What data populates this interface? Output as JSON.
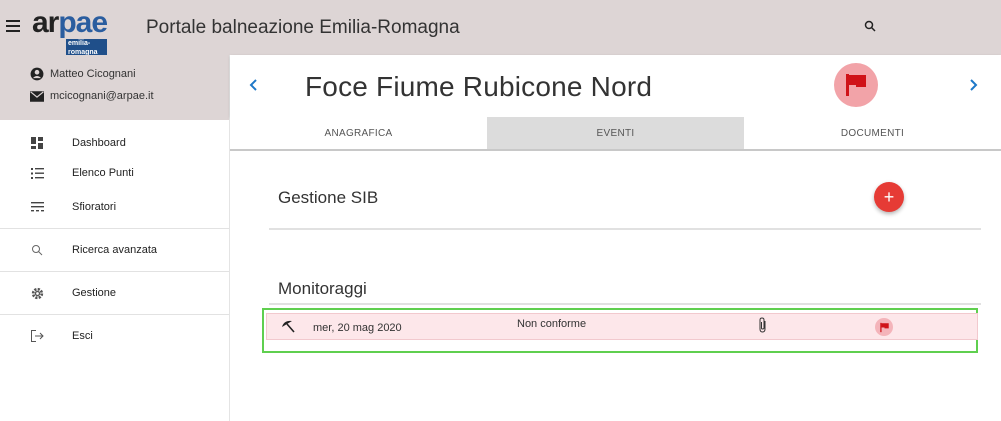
{
  "app": {
    "logo_text_1": "ar",
    "logo_text_2": "pae",
    "logo_sub": "emilia-romagna",
    "title": "Portale balneazione Emilia-Romagna"
  },
  "user": {
    "name": "Matteo Cicognani",
    "email": "mcicognani@arpae.it"
  },
  "sidebar": {
    "items": [
      {
        "label": "Dashboard",
        "icon": "dashboard-icon"
      },
      {
        "label": "Elenco Punti",
        "icon": "list-icon"
      },
      {
        "label": "Sfioratori",
        "icon": "overflow-icon"
      },
      {
        "label": "Ricerca avanzata",
        "icon": "search-icon"
      },
      {
        "label": "Gestione",
        "icon": "gear-icon"
      },
      {
        "label": "Esci",
        "icon": "logout-icon"
      }
    ]
  },
  "station": {
    "name": "Foce Fiume Rubicone Nord",
    "status_icon": "red-flag-icon"
  },
  "tabs": [
    {
      "label": "ANAGRAFICA",
      "active": false
    },
    {
      "label": "EVENTI",
      "active": true
    },
    {
      "label": "DOCUMENTI",
      "active": false
    }
  ],
  "sections": {
    "sib_title": "Gestione SIB",
    "add_label": "+",
    "monitoring_title": "Monitoraggi"
  },
  "monitoring": [
    {
      "date": "mer, 20 mag 2020",
      "result": "Non conforme",
      "attachment": true,
      "flag": "red"
    }
  ],
  "colors": {
    "topbar": "#ddd5d5",
    "accent_red": "#e63b35",
    "row_bg": "#fde7ea",
    "highlight": "#5fcf4f"
  }
}
